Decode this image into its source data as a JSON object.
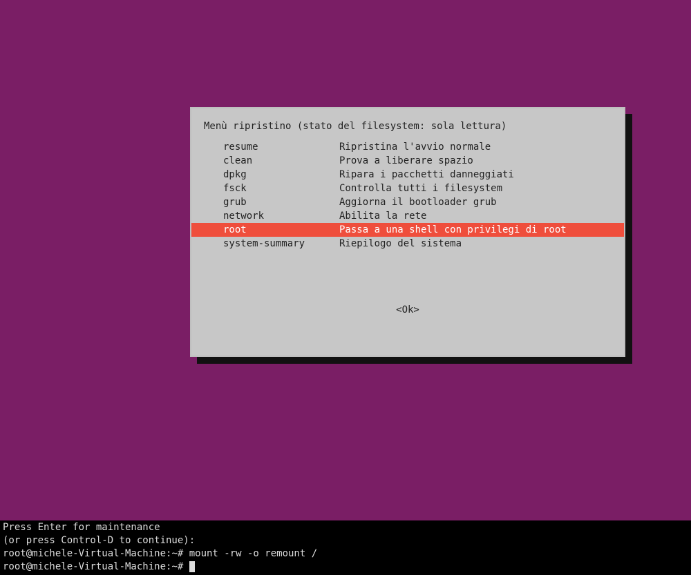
{
  "dialog": {
    "title": "Menù ripristino (stato del filesystem: sola lettura)",
    "selected_index": 6,
    "items": [
      {
        "key": "resume",
        "desc": "Ripristina l'avvio normale"
      },
      {
        "key": "clean",
        "desc": "Prova a liberare spazio"
      },
      {
        "key": "dpkg",
        "desc": "Ripara i pacchetti danneggiati"
      },
      {
        "key": "fsck",
        "desc": "Controlla tutti i filesystem"
      },
      {
        "key": "grub",
        "desc": "Aggiorna il bootloader grub"
      },
      {
        "key": "network",
        "desc": "Abilita la rete"
      },
      {
        "key": "root",
        "desc": "Passa a una shell con privilegi di root"
      },
      {
        "key": "system-summary",
        "desc": "Riepilogo del sistema"
      }
    ],
    "ok_label": "<Ok>"
  },
  "terminal": {
    "line1": "Press Enter for maintenance",
    "line2": "(or press Control-D to continue):",
    "line3": "root@michele-Virtual-Machine:~# mount -rw -o remount /",
    "line4": "root@michele-Virtual-Machine:~# "
  }
}
